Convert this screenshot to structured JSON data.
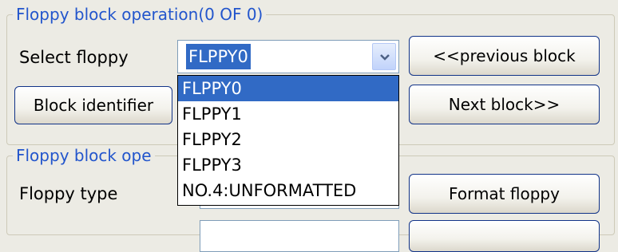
{
  "group1": {
    "title": "Floppy block operation(0 OF 0)",
    "select_label": "Select floppy",
    "selected_value": "FLPPY0",
    "prev_button": "<<previous block",
    "block_id_button": "Block identifier",
    "next_button": "Next block>>"
  },
  "dropdown": {
    "options": [
      "FLPPY0",
      "FLPPY1",
      "FLPPY2",
      "FLPPY3",
      "NO.4:UNFORMATTED"
    ],
    "highlighted_index": 0
  },
  "group2": {
    "title": "Floppy block ope",
    "type_label": "Floppy type",
    "format_button": "Format floppy"
  },
  "colors": {
    "background": "#ecebe4",
    "legend_text": "#2255cc",
    "selection": "#316ac5",
    "button_border": "#113388"
  },
  "icons": {
    "combo_arrow": "chevron-down-icon"
  }
}
